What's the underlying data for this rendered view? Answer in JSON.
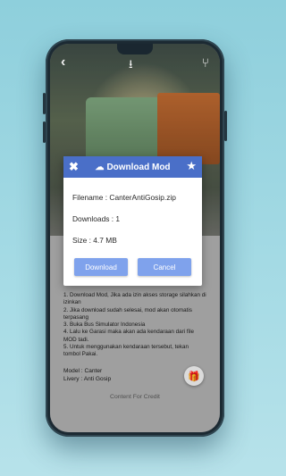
{
  "top_bar": {
    "back_icon": "arrow-left-icon",
    "download_icon": "download-tray-icon",
    "share_icon": "share-icon"
  },
  "dialog": {
    "title": "Download Mod",
    "close_icon": "close-icon",
    "star_icon": "star-icon",
    "cloud_icon": "cloud-download-icon",
    "filename": "Filename : CanterAntiGosip.zip",
    "downloads": "Downloads : 1",
    "size": "Size : 4.7 MB",
    "download_label": "Download",
    "cancel_label": "Cancel",
    "header_color": "#4a6fc8",
    "button_color": "#7fa2ec"
  },
  "content": {
    "instructions": [
      "1. Download Mod, Jika ada izin akses storage silahkan di izinkan",
      "2. Jika download sudah selesai, mod akan otomatis terpasang",
      "3. Buka Bus Simulator Indonesia",
      "4. Lalu ke Garasi maka akan ada kendaraan dari file MOD tadi.",
      "5. Untuk menggunakan kendaraan tersebut, tekan tombol Pakai."
    ],
    "model": "Model : Canter",
    "livery": "Livery : Anti Gosip",
    "credit": "Content For Credit",
    "gift_icon": "gift-icon"
  }
}
